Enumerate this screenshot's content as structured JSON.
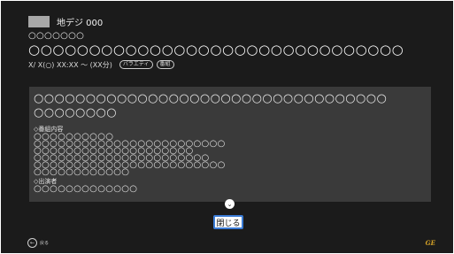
{
  "program": {
    "channel": "地デジ 000",
    "subtitle": "○○○○○○○",
    "title": "○○○○○○○○○○○○○○○○○○○○○○○○○○○○○○○",
    "time": "X/ X(○) XX:XX 〜 (XX分)",
    "tags": [
      "バラエティ",
      "番組"
    ]
  },
  "details": {
    "summary": [
      "○○○○○○○○○○○○○○○○○○○○○○○○○○○○○○○○○○",
      "○○○○○○○○"
    ],
    "content_label": "◇番組内容",
    "content_lines": [
      "○○○○○○○○○○",
      "○○○○○○○○○○○○○○○○○○○○○○○○",
      "○○○○○○○○○○○○○○○○○○○○",
      "○○○○○○○○○○○○○○○○○○○○○○",
      "○○○○○○○○○○○○○○○○○○○○○○○○",
      "○○○○○○○○○○○○"
    ],
    "cast_label": "◇出演者",
    "cast_lines": [
      "○○○○○○○○○○○○○"
    ]
  },
  "controls": {
    "close_label": "閉じる",
    "back_label": "戻る",
    "back_glyph": "←",
    "more_glyph": "⌄",
    "brand": "GE"
  },
  "colors": {
    "accent": "#3a7bd5",
    "brand": "#d8a427",
    "panel": "#3a3a3a",
    "background": "#1b1b1b"
  }
}
